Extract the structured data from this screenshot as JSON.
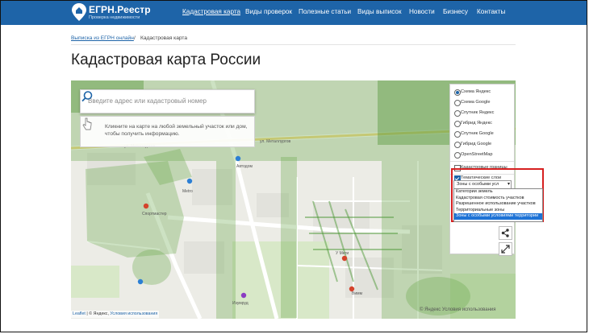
{
  "header": {
    "brand": "ЕГРН.Реестр",
    "brand_sub": "Проверка недвижимости",
    "nav": [
      {
        "label": "Кадастровая карта",
        "active": true
      },
      {
        "label": "Виды проверок"
      },
      {
        "label": "Полезные статьи"
      },
      {
        "label": "Виды выписок"
      },
      {
        "label": "Новости"
      },
      {
        "label": "Бизнесу"
      },
      {
        "label": "Контакты"
      }
    ]
  },
  "breadcrumb": {
    "link": "Выписка из ЕГРН онлайн",
    "separator": "/",
    "current": "Кадастровая карта"
  },
  "page_title": "Кадастровая карта России",
  "map": {
    "search_placeholder": "Введите адрес или кадастровый номер",
    "hint": "Кликните на карте на любой земельный участок или дом, чтобы получить информацию.",
    "base_layers": [
      {
        "label": "Схема Яндекс",
        "selected": true
      },
      {
        "label": "Схема Google"
      },
      {
        "label": "Спутник Яндекс"
      },
      {
        "label": "Гибрид Яндекс"
      },
      {
        "label": "Спутник Google"
      },
      {
        "label": "Гибрид Google"
      },
      {
        "label": "OpenStreetMap"
      }
    ],
    "cadastral_borders": {
      "label": "Кадастровые границы",
      "checked": false
    },
    "thematic_layers": {
      "label": "Тематические слои",
      "checked": true
    },
    "layer_select_value": "Зоны с особыми усл",
    "layer_options": [
      "Категории земель",
      "Кадастровая стоимость участков",
      "Разрешенное использование участков",
      "Территориальные зоны",
      "Зоны с особыми условиями территории"
    ],
    "selected_option_index": 4,
    "street_labels": [
      "ул. Металлургов",
      "ул. Металлургов",
      "Metro",
      "Спортмастер",
      "Автодом",
      "Изумруд",
      "Вимм",
      "У Меги"
    ],
    "attribution": {
      "leaflet": "Leaflet",
      "sep": "| ©",
      "yandex": "Яндекс,",
      "terms": "Условия использования"
    },
    "attribution_right": "© Яндекс Условия использования",
    "accent_color": "#1e64a8",
    "highlight_color": "#d62020"
  }
}
